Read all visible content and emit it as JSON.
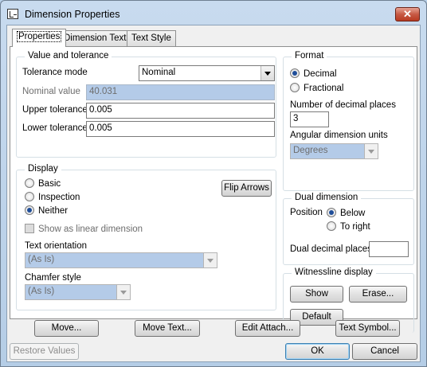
{
  "window": {
    "title": "Dimension Properties",
    "close_glyph": "✕"
  },
  "tabs": [
    {
      "label": "Properties"
    },
    {
      "label": "Dimension Text"
    },
    {
      "label": "Text Style"
    }
  ],
  "value_tolerance": {
    "group_label": "Value and tolerance",
    "tolerance_mode_label": "Tolerance mode",
    "tolerance_mode_value": "Nominal",
    "nominal_value_label": "Nominal value",
    "nominal_value": "40.031",
    "upper_tolerance_label": "Upper tolerance",
    "upper_tolerance": "0.005",
    "lower_tolerance_label": "Lower tolerance",
    "lower_tolerance": "0.005"
  },
  "format": {
    "group_label": "Format",
    "decimal_label": "Decimal",
    "fractional_label": "Fractional",
    "selected": "Decimal",
    "decimal_places_label": "Number of decimal places",
    "decimal_places": "3",
    "angular_units_label": "Angular dimension units",
    "angular_units_value": "Degrees"
  },
  "display": {
    "group_label": "Display",
    "basic_label": "Basic",
    "inspection_label": "Inspection",
    "neither_label": "Neither",
    "selected": "Neither",
    "flip_arrows_label": "Flip Arrows",
    "show_linear_label": "Show as linear dimension",
    "text_orientation_label": "Text orientation",
    "text_orientation_value": "(As Is)",
    "chamfer_style_label": "Chamfer style",
    "chamfer_style_value": "(As Is)"
  },
  "dual_dimension": {
    "group_label": "Dual dimension",
    "position_label": "Position",
    "below_label": "Below",
    "to_right_label": "To right",
    "selected": "Below",
    "dual_places_label": "Dual decimal places",
    "dual_places_value": ""
  },
  "witnessline": {
    "group_label": "Witnessline display",
    "show_label": "Show",
    "erase_label": "Erase...",
    "default_label": "Default"
  },
  "action_buttons": {
    "move": "Move...",
    "move_text": "Move Text...",
    "edit_attach": "Edit Attach...",
    "text_symbol": "Text Symbol..."
  },
  "footer": {
    "restore_values": "Restore Values",
    "ok": "OK",
    "cancel": "Cancel"
  }
}
